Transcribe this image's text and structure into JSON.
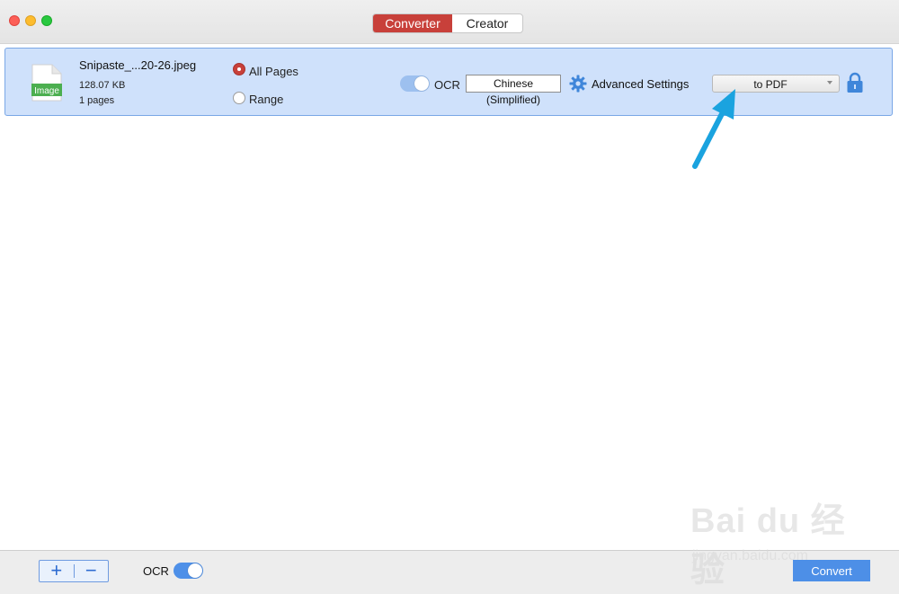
{
  "window": {
    "tabs": [
      {
        "label": "Converter",
        "active": true
      },
      {
        "label": "Creator",
        "active": false
      }
    ]
  },
  "file": {
    "icon_label": "Image",
    "name": "Snipaste_...20-26.jpeg",
    "size": "128.07 KB",
    "pages": "1 pages",
    "page_options": {
      "all_pages_label": "All Pages",
      "range_label": "Range",
      "selected": "All Pages"
    },
    "ocr": {
      "label": "OCR",
      "enabled": true,
      "language": "Chinese (Simplified)"
    },
    "advanced_settings_label": "Advanced Settings",
    "output_format": "to PDF"
  },
  "bottom": {
    "add_label": "+",
    "remove_label": "−",
    "ocr_label": "OCR",
    "ocr_enabled": true,
    "convert_label": "Convert"
  },
  "watermark": {
    "brand": "Bai du 经验",
    "site": "jingyan.baidu.com"
  },
  "colors": {
    "accent_red": "#c8403a",
    "row_highlight": "#cfe1fb",
    "accent_blue": "#4d8fe7",
    "annotation_arrow": "#1aa3df"
  }
}
